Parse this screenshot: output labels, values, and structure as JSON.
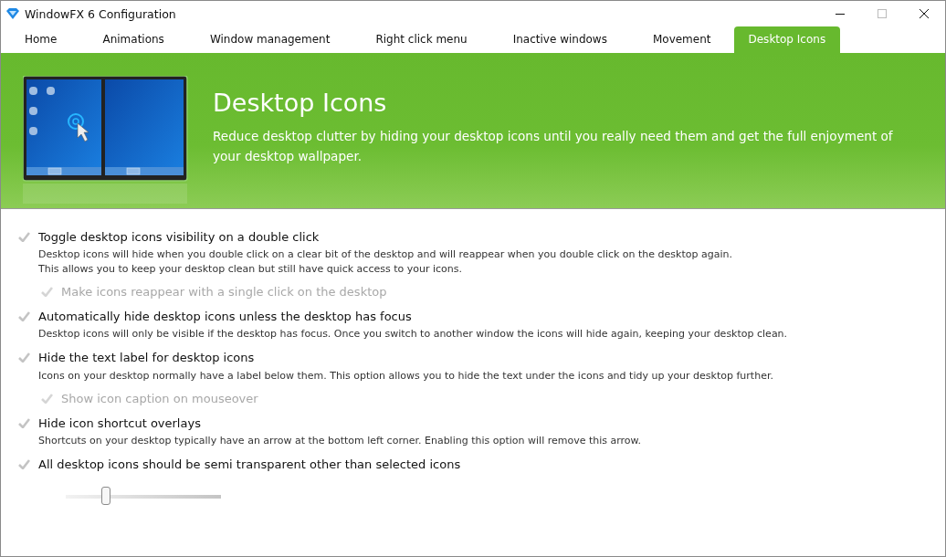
{
  "window": {
    "title": "WindowFX 6 Configuration"
  },
  "tabs": [
    {
      "label": "Home",
      "selected": false
    },
    {
      "label": "Animations",
      "selected": false
    },
    {
      "label": "Window management",
      "selected": false
    },
    {
      "label": "Right click menu",
      "selected": false
    },
    {
      "label": "Inactive windows",
      "selected": false
    },
    {
      "label": "Movement",
      "selected": false
    },
    {
      "label": "Desktop Icons",
      "selected": true
    }
  ],
  "banner": {
    "title": "Desktop Icons",
    "description": "Reduce desktop clutter by hiding your desktop icons until you really need them and get the full enjoyment of your desktop wallpaper."
  },
  "options": [
    {
      "label": "Toggle desktop icons visibility on a double click",
      "checked": false,
      "description": [
        "Desktop icons will hide when you double click on a clear bit of the desktop and will reappear when you double click on the desktop again.",
        "This allows you to keep your desktop clean but still have quick access to your icons."
      ],
      "suboption": {
        "label": "Make icons reappear with a single click on the desktop",
        "checked": false,
        "disabled": true
      }
    },
    {
      "label": "Automatically hide desktop icons unless the desktop has focus",
      "checked": false,
      "description": [
        "Desktop icons will only be visible if the desktop has focus.  Once you switch to another window the icons will hide again, keeping your desktop clean."
      ]
    },
    {
      "label": "Hide the text label for desktop icons",
      "checked": false,
      "description": [
        "Icons on your desktop normally have a label below them.  This option allows you to hide the text under the icons and tidy up your desktop further."
      ],
      "suboption": {
        "label": "Show icon caption on mouseover",
        "checked": false,
        "disabled": true
      }
    },
    {
      "label": "Hide icon shortcut overlays",
      "checked": false,
      "description": [
        "Shortcuts on your desktop typically have an arrow at the bottom left corner.  Enabling this option will remove this arrow."
      ]
    },
    {
      "label": "All desktop icons should be semi transparent other than selected icons",
      "checked": false,
      "slider": {
        "level": 0.26
      }
    }
  ]
}
